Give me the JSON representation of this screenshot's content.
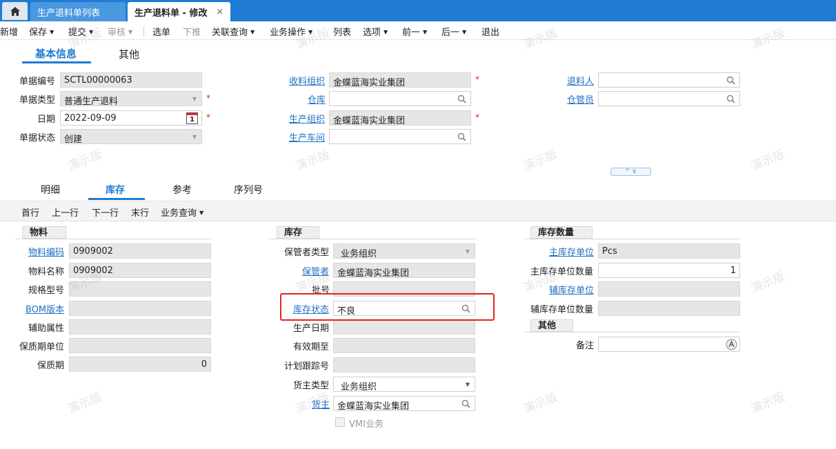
{
  "tabs": {
    "home_icon": "home-icon",
    "list_tab": "生产退料单列表",
    "edit_tab": "生产退料单 - 修改",
    "close": "×"
  },
  "toolbar": {
    "new": "新增",
    "save": "保存",
    "submit": "提交",
    "audit": "审核",
    "select_bill": "选单",
    "push_down": "下推",
    "related_query": "关联查询",
    "business_ops": "业务操作",
    "list": "列表",
    "options": "选项",
    "prev": "前一",
    "next": "后一",
    "exit": "退出"
  },
  "header_tabs": {
    "basic": "基本信息",
    "other": "其他"
  },
  "basic": {
    "bill_no_label": "单据编号",
    "bill_no": "SCTL00000063",
    "bill_type_label": "单据类型",
    "bill_type": "普通生产退料",
    "date_label": "日期",
    "date": "2022-09-09",
    "calendar_day": "1",
    "status_label": "单据状态",
    "status": "创建",
    "recv_org_label": "收料组织",
    "recv_org": "金蝶蓝海实业集团",
    "warehouse_label": "仓库",
    "warehouse": "",
    "prod_org_label": "生产组织",
    "prod_org": "金蝶蓝海实业集团",
    "workshop_label": "生产车间",
    "workshop": "",
    "returner_label": "退料人",
    "returner": "",
    "keeper_label": "仓管员",
    "keeper": "",
    "required": "*"
  },
  "collapse_glyph": "^ ∨",
  "detail_tabs": {
    "detail": "明细",
    "stock": "库存",
    "ref": "参考",
    "serial": "序列号"
  },
  "subbar": {
    "first": "首行",
    "prev": "上一行",
    "next": "下一行",
    "last": "末行",
    "query": "业务查询"
  },
  "material": {
    "section": "物料",
    "code_label": "物料编码",
    "code": "0909002",
    "name_label": "物料名称",
    "name": "0909002",
    "spec_label": "规格型号",
    "spec": "",
    "bom_label": "BOM版本",
    "bom": "",
    "aux_label": "辅助属性",
    "aux": "",
    "shelf_unit_label": "保质期单位",
    "shelf_unit": "",
    "shelf_label": "保质期",
    "shelf": "0"
  },
  "stock": {
    "section": "库存",
    "keeper_type_label": "保管者类型",
    "keeper_type": "业务组织",
    "keeper_label": "保管者",
    "keeper": "金蝶蓝海实业集团",
    "lot_label": "批号",
    "lot": "",
    "stock_status_label": "库存状态",
    "stock_status": "不良",
    "prod_date_label": "生产日期",
    "prod_date": "",
    "expiry_label": "有效期至",
    "expiry": "",
    "mto_label": "计划跟踪号",
    "mto": "",
    "owner_type_label": "货主类型",
    "owner_type": "业务组织",
    "owner_label": "货主",
    "owner": "金蝶蓝海实业集团",
    "vmi_label": "VMI业务"
  },
  "qty": {
    "section": "库存数量",
    "main_unit_label": "主库存单位",
    "main_unit": "Pcs",
    "main_qty_label": "主库存单位数量",
    "main_qty": "1",
    "aux_unit_label": "辅库存单位",
    "aux_unit": "",
    "aux_qty_label": "辅库存单位数量",
    "aux_qty": ""
  },
  "other": {
    "section": "其他",
    "remark_label": "备注",
    "remark": ""
  },
  "watermark": "演示版"
}
